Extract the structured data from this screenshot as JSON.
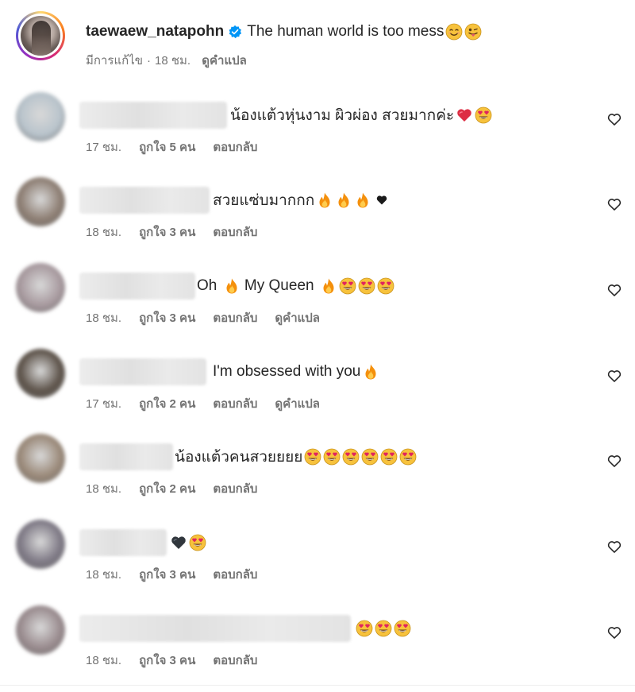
{
  "post": {
    "author_username": "taewaew_natapohn",
    "caption": "The human world is too mess",
    "caption_emojis": [
      "smiling-face-icon",
      "winking-tongue-face-icon"
    ],
    "edited_label": "มีการแก้ไข",
    "separator": "·",
    "time_ago": "18 ชม.",
    "translate_label": "ดูคำแปล",
    "verified_color": "#0095f6",
    "story_ring_colors": [
      "#feda75",
      "#fa7e1e",
      "#d62976",
      "#962fbf",
      "#4f5bd5"
    ]
  },
  "comments": [
    {
      "text": "น้องแต้วหุ่นงาม ผิวผ่อง สวยมากค่ะ",
      "emojis": [
        "red-heart-icon",
        "heart-eyes-icon"
      ],
      "time": "17 ชม.",
      "likes": "ถูกใจ 5 คน",
      "reply": "ตอบกลับ",
      "translate": null,
      "avatar_color": "#b9c4cc"
    },
    {
      "text": "สวยแซ่บมากกก",
      "emojis": [
        "fire-icon",
        "fire-icon",
        "fire-icon",
        "black-small-heart-icon"
      ],
      "time": "18 ชม.",
      "likes": "ถูกใจ 3 คน",
      "reply": "ตอบกลับ",
      "translate": null,
      "avatar_color": "#8e7f74"
    },
    {
      "text": "Oh",
      "text2": "My Queen",
      "emojis": [
        "fire-icon",
        "heart-eyes-icon",
        "heart-eyes-icon",
        "heart-eyes-icon"
      ],
      "time": "18 ชม.",
      "likes": "ถูกใจ 3 คน",
      "reply": "ตอบกลับ",
      "translate": "ดูคำแปล",
      "avatar_color": "#a89a9f"
    },
    {
      "text": "I'm obsessed with you",
      "emojis": [
        "fire-icon"
      ],
      "time": "17 ชม.",
      "likes": "ถูกใจ 2 คน",
      "reply": "ตอบกลับ",
      "translate": "ดูคำแปล",
      "avatar_color": "#5e544b"
    },
    {
      "text": "น้องแต้วคนสวยยยย",
      "emojis": [
        "heart-eyes-icon",
        "heart-eyes-icon",
        "heart-eyes-icon",
        "heart-eyes-icon",
        "heart-eyes-icon",
        "heart-eyes-icon"
      ],
      "time": "18 ชม.",
      "likes": "ถูกใจ 2 คน",
      "reply": "ตอบกลับ",
      "translate": null,
      "avatar_color": "#9b8a7a"
    },
    {
      "text": "",
      "emojis": [
        "black-heart-icon",
        "heart-eyes-icon"
      ],
      "time": "18 ชม.",
      "likes": "ถูกใจ 3 คน",
      "reply": "ตอบกลับ",
      "translate": null,
      "avatar_color": "#7f7a86"
    },
    {
      "text": "",
      "emojis": [
        "heart-eyes-icon",
        "heart-eyes-icon",
        "heart-eyes-icon"
      ],
      "time": "18 ชม.",
      "likes": "ถูกใจ 3 คน",
      "reply": "ตอบกลับ",
      "translate": null,
      "avatar_color": "#9a8c8f"
    }
  ]
}
